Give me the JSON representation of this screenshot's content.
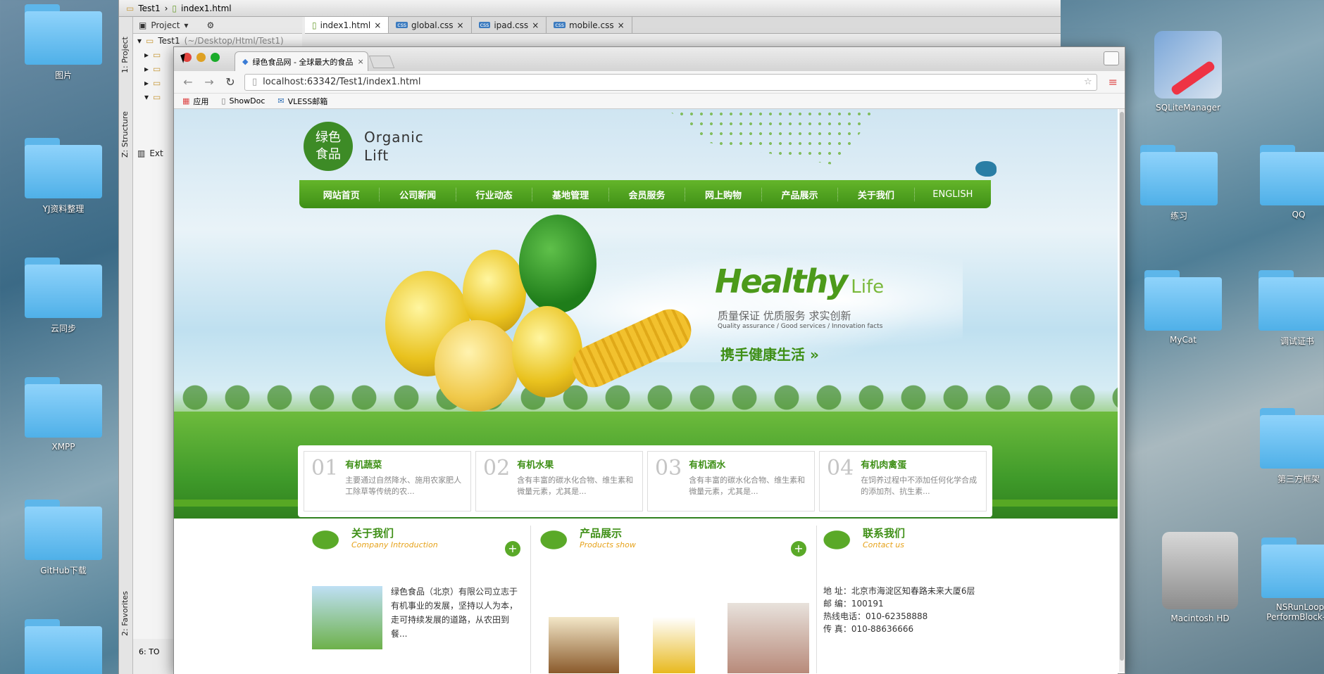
{
  "desktop": {
    "left_icons": [
      {
        "label": "图片"
      },
      {
        "label": "YJ资料整理"
      },
      {
        "label": "云同步"
      },
      {
        "label": "XMPP"
      },
      {
        "label": "GitHub下载"
      }
    ],
    "right_icons": [
      {
        "label": "SQLiteManager"
      },
      {
        "label": "练习"
      },
      {
        "label": "QQ"
      },
      {
        "label": "MyCat"
      },
      {
        "label": "调试证书"
      },
      {
        "label": "第三方框架"
      },
      {
        "label": "Macintosh HD"
      },
      {
        "label": "NSRunLoop PerformBlock-m"
      }
    ]
  },
  "ide": {
    "breadcrumb": [
      "Test1",
      "index1.html"
    ],
    "project_label": "Project",
    "tree_root": "Test1",
    "tree_root_path": "(~/Desktop/Html/Test1)",
    "tree_ext": "Ext",
    "side_labels": [
      "1: Project",
      "Z: Structure",
      "2: Favorites"
    ],
    "bottom_label": "6: TO",
    "tabs": [
      {
        "label": "index1.html",
        "kind": "html"
      },
      {
        "label": "global.css",
        "kind": "css"
      },
      {
        "label": "ipad.css",
        "kind": "css"
      },
      {
        "label": "mobile.css",
        "kind": "css"
      }
    ]
  },
  "browser": {
    "tab_title": "绿色食品网 - 全球最大的食品",
    "url": "localhost:63342/Test1/index1.html",
    "bookmarks": [
      "应用",
      "ShowDoc",
      "VLESS邮箱"
    ]
  },
  "site": {
    "logo_cn": [
      "绿色",
      "食品"
    ],
    "logo_en": [
      "Organic",
      "Lift"
    ],
    "nav": [
      "网站首页",
      "公司新闻",
      "行业动态",
      "基地管理",
      "会员服务",
      "网上购物",
      "产品展示",
      "关于我们",
      "ENGLISH"
    ],
    "hero": {
      "title": "Healthy",
      "title_small": "Life",
      "slogan": "质量保证 优质服务 求实创新",
      "slogan_en": "Quality assurance / Good services / Innovation facts",
      "cta": "携手健康生活 »"
    },
    "features": [
      {
        "num": "01",
        "title": "有机蔬菜",
        "desc": "主要通过自然降水、施用农家肥人工除草等传统的农..."
      },
      {
        "num": "02",
        "title": "有机水果",
        "desc": "含有丰富的碳水化合物、维生素和微量元素，尤其是..."
      },
      {
        "num": "03",
        "title": "有机酒水",
        "desc": "含有丰富的碳水化合物、维生素和微量元素，尤其是..."
      },
      {
        "num": "04",
        "title": "有机肉禽蛋",
        "desc": "在饲养过程中不添加任何化学合成的添加剂、抗生素..."
      }
    ],
    "about": {
      "title": "关于我们",
      "subtitle": "Company Introduction",
      "text": "绿色食品（北京）有限公司立志于有机事业的发展，坚持以人为本，走可持续发展的道路，从农田到餐..."
    },
    "products": {
      "title": "产品展示",
      "subtitle": "Products show"
    },
    "contact": {
      "title": "联系我们",
      "subtitle": "Contact us",
      "address": "地  址：北京市海淀区知春路未来大厦6层",
      "postcode": "邮  编：100191",
      "phone": "热线电话：010-62358888",
      "fax": "传  真：010-88636666"
    }
  },
  "colors": {
    "brand_green": "#3e8f16",
    "accent_orange": "#e6a21a"
  }
}
